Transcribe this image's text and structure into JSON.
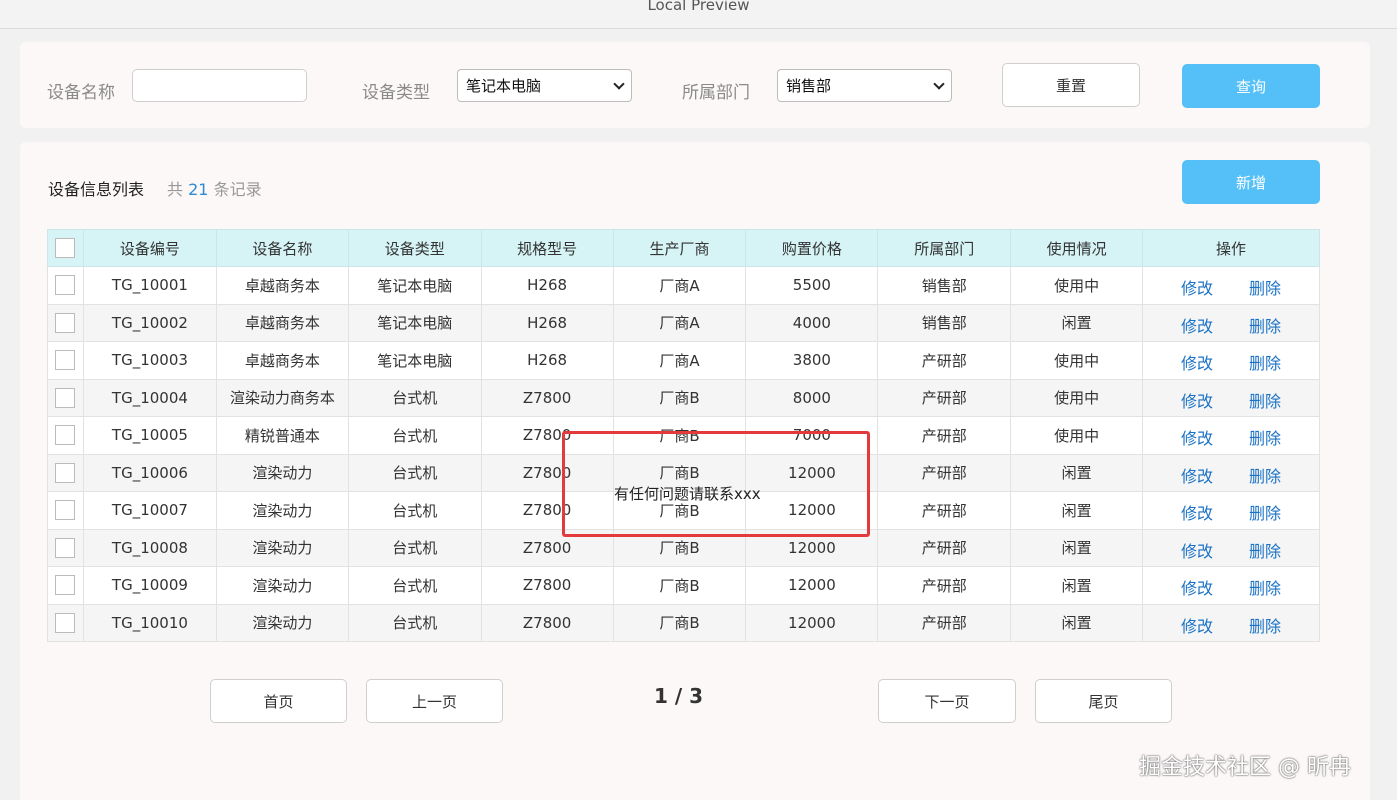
{
  "window": {
    "title": "Local Preview"
  },
  "search": {
    "name_label": "设备名称",
    "name_value": "",
    "type_label": "设备类型",
    "type_value": "笔记本电脑",
    "dept_label": "所属部门",
    "dept_value": "销售部",
    "reset_label": "重置",
    "query_label": "查询"
  },
  "list": {
    "title": "设备信息列表",
    "count_prefix": "共",
    "count": "21",
    "count_suffix": "条记录",
    "add_label": "新增",
    "columns": [
      "设备编号",
      "设备名称",
      "设备类型",
      "规格型号",
      "生产厂商",
      "购置价格",
      "所属部门",
      "使用情况",
      "操作"
    ],
    "edit_label": "修改",
    "delete_label": "删除",
    "rows": [
      {
        "id": "TG_10001",
        "name": "卓越商务本",
        "type": "笔记本电脑",
        "model": "H268",
        "maker": "厂商A",
        "price": "5500",
        "dept": "销售部",
        "status": "使用中"
      },
      {
        "id": "TG_10002",
        "name": "卓越商务本",
        "type": "笔记本电脑",
        "model": "H268",
        "maker": "厂商A",
        "price": "4000",
        "dept": "销售部",
        "status": "闲置"
      },
      {
        "id": "TG_10003",
        "name": "卓越商务本",
        "type": "笔记本电脑",
        "model": "H268",
        "maker": "厂商A",
        "price": "3800",
        "dept": "产研部",
        "status": "使用中"
      },
      {
        "id": "TG_10004",
        "name": "渲染动力商务本",
        "type": "台式机",
        "model": "Z7800",
        "maker": "厂商B",
        "price": "8000",
        "dept": "产研部",
        "status": "使用中"
      },
      {
        "id": "TG_10005",
        "name": "精锐普通本",
        "type": "台式机",
        "model": "Z7800",
        "maker": "厂商B",
        "price": "7000",
        "dept": "产研部",
        "status": "使用中"
      },
      {
        "id": "TG_10006",
        "name": "渲染动力",
        "type": "台式机",
        "model": "Z7800",
        "maker": "厂商B",
        "price": "12000",
        "dept": "产研部",
        "status": "闲置"
      },
      {
        "id": "TG_10007",
        "name": "渲染动力",
        "type": "台式机",
        "model": "Z7800",
        "maker": "厂商B",
        "price": "12000",
        "dept": "产研部",
        "status": "闲置"
      },
      {
        "id": "TG_10008",
        "name": "渲染动力",
        "type": "台式机",
        "model": "Z7800",
        "maker": "厂商B",
        "price": "12000",
        "dept": "产研部",
        "status": "闲置"
      },
      {
        "id": "TG_10009",
        "name": "渲染动力",
        "type": "台式机",
        "model": "Z7800",
        "maker": "厂商B",
        "price": "12000",
        "dept": "产研部",
        "status": "闲置"
      },
      {
        "id": "TG_10010",
        "name": "渲染动力",
        "type": "台式机",
        "model": "Z7800",
        "maker": "厂商B",
        "price": "12000",
        "dept": "产研部",
        "status": "闲置"
      }
    ]
  },
  "pagination": {
    "first_label": "首页",
    "prev_label": "上一页",
    "page_info": "1 / 3",
    "next_label": "下一页",
    "last_label": "尾页"
  },
  "overlay": {
    "text": "有任何问题请联系xxx"
  },
  "watermark": "掘金技术社区 @ 昕冉"
}
